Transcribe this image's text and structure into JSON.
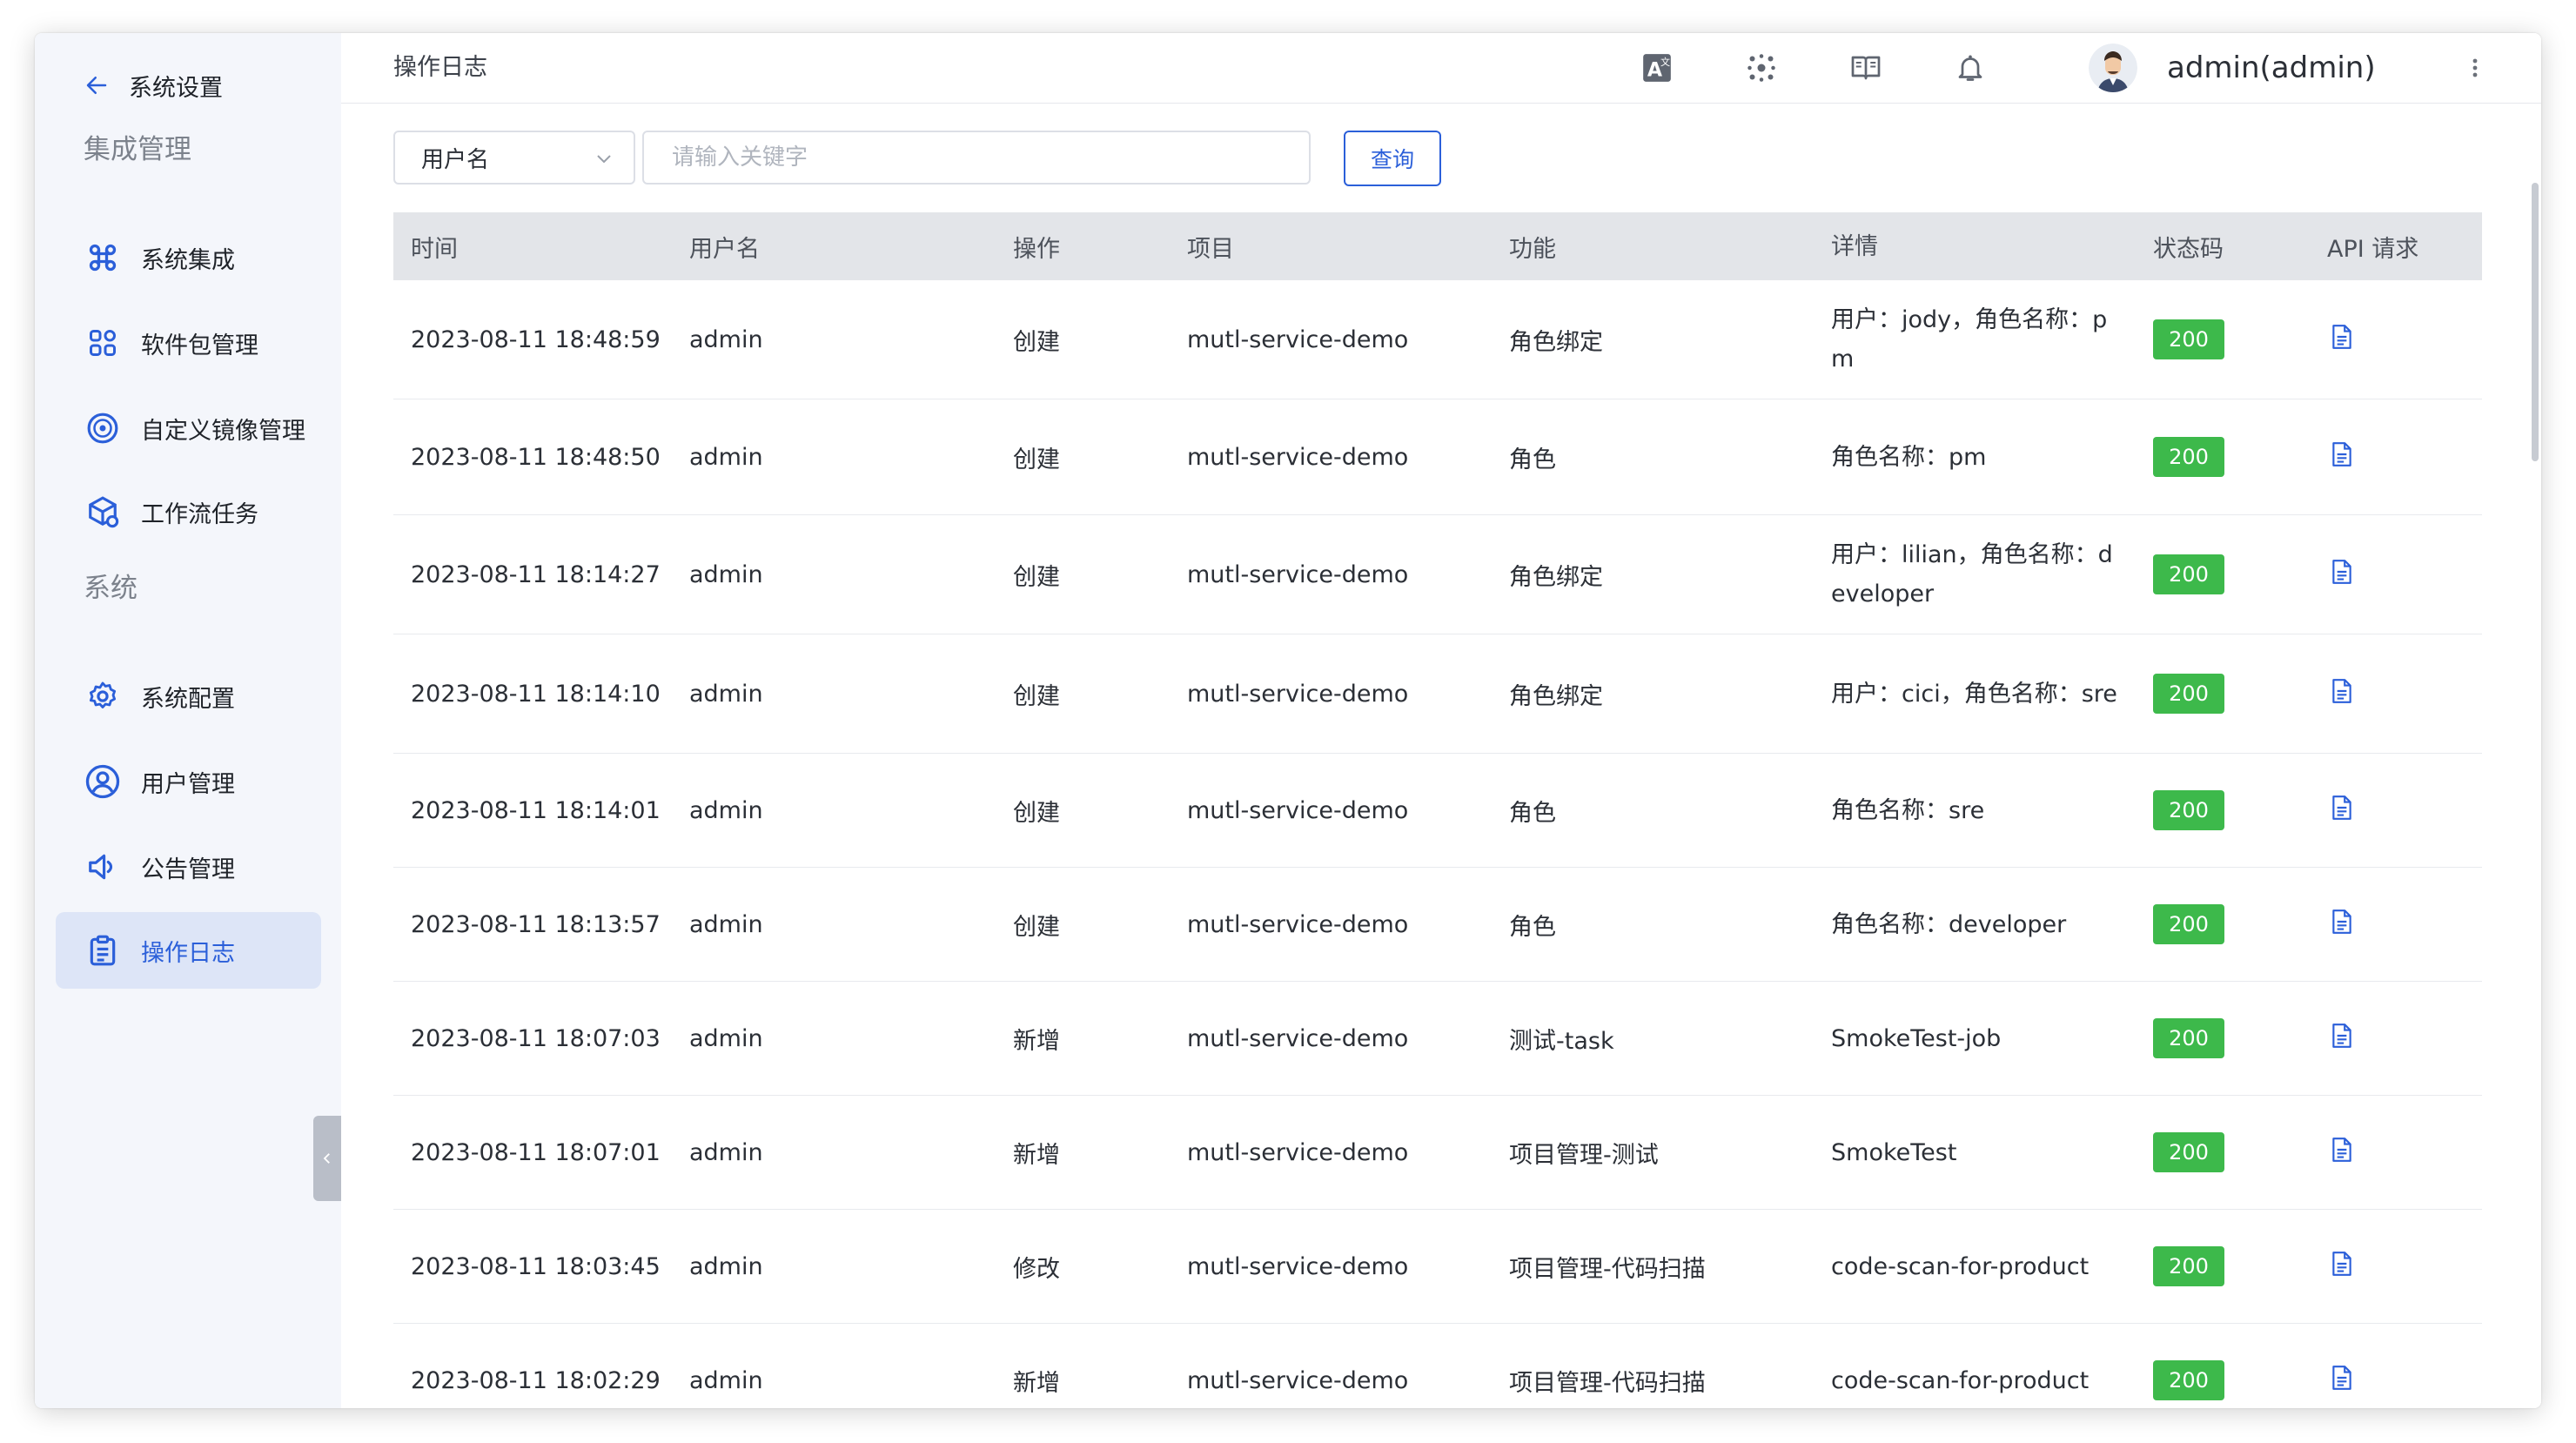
{
  "sidebar": {
    "back_label": "系统设置",
    "groups": [
      {
        "title": "集成管理"
      },
      {
        "title": "系统"
      }
    ],
    "items": [
      {
        "label": "系统集成",
        "icon": "command-icon"
      },
      {
        "label": "软件包管理",
        "icon": "apps-grid-icon"
      },
      {
        "label": "自定义镜像管理",
        "icon": "disc-icon"
      },
      {
        "label": "工作流任务",
        "icon": "cube-gear-icon"
      },
      {
        "label": "系统配置",
        "icon": "gear-icon"
      },
      {
        "label": "用户管理",
        "icon": "user-circle-icon"
      },
      {
        "label": "公告管理",
        "icon": "speaker-icon"
      },
      {
        "label": "操作日志",
        "icon": "clipboard-icon",
        "active": true
      }
    ]
  },
  "header": {
    "breadcrumb": "操作日志",
    "user": "admin(admin)"
  },
  "search": {
    "field": "用户名",
    "placeholder": "请输入关键字",
    "button": "查询"
  },
  "table": {
    "headers": [
      "时间",
      "用户名",
      "操作",
      "项目",
      "功能",
      "详情",
      "状态码",
      "API 请求"
    ],
    "rows": [
      {
        "time": "2023-08-11 18:48:59",
        "user": "admin",
        "op": "创建",
        "project": "mutl-service-demo",
        "func": "角色绑定",
        "detail": "用户：jody，角色名称：pm",
        "status": "200"
      },
      {
        "time": "2023-08-11 18:48:50",
        "user": "admin",
        "op": "创建",
        "project": "mutl-service-demo",
        "func": "角色",
        "detail": "角色名称：pm",
        "status": "200"
      },
      {
        "time": "2023-08-11 18:14:27",
        "user": "admin",
        "op": "创建",
        "project": "mutl-service-demo",
        "func": "角色绑定",
        "detail": "用户：lilian，角色名称：developer",
        "status": "200"
      },
      {
        "time": "2023-08-11 18:14:10",
        "user": "admin",
        "op": "创建",
        "project": "mutl-service-demo",
        "func": "角色绑定",
        "detail": "用户：cici，角色名称：sre",
        "status": "200"
      },
      {
        "time": "2023-08-11 18:14:01",
        "user": "admin",
        "op": "创建",
        "project": "mutl-service-demo",
        "func": "角色",
        "detail": "角色名称：sre",
        "status": "200"
      },
      {
        "time": "2023-08-11 18:13:57",
        "user": "admin",
        "op": "创建",
        "project": "mutl-service-demo",
        "func": "角色",
        "detail": "角色名称：developer",
        "status": "200"
      },
      {
        "time": "2023-08-11 18:07:03",
        "user": "admin",
        "op": "新增",
        "project": "mutl-service-demo",
        "func": "测试-task",
        "detail": "SmokeTest-job",
        "status": "200"
      },
      {
        "time": "2023-08-11 18:07:01",
        "user": "admin",
        "op": "新增",
        "project": "mutl-service-demo",
        "func": "项目管理-测试",
        "detail": "SmokeTest",
        "status": "200"
      },
      {
        "time": "2023-08-11 18:03:45",
        "user": "admin",
        "op": "修改",
        "project": "mutl-service-demo",
        "func": "项目管理-代码扫描",
        "detail": "code-scan-for-product",
        "status": "200"
      },
      {
        "time": "2023-08-11 18:02:29",
        "user": "admin",
        "op": "新增",
        "project": "mutl-service-demo",
        "func": "项目管理-代码扫描",
        "detail": "code-scan-for-product",
        "status": "200"
      }
    ]
  },
  "colors": {
    "accent": "#2b5fd9",
    "status_ok": "#3db94b",
    "sidebar_bg": "#f4f6fb",
    "active_bg": "#dde5f7"
  }
}
